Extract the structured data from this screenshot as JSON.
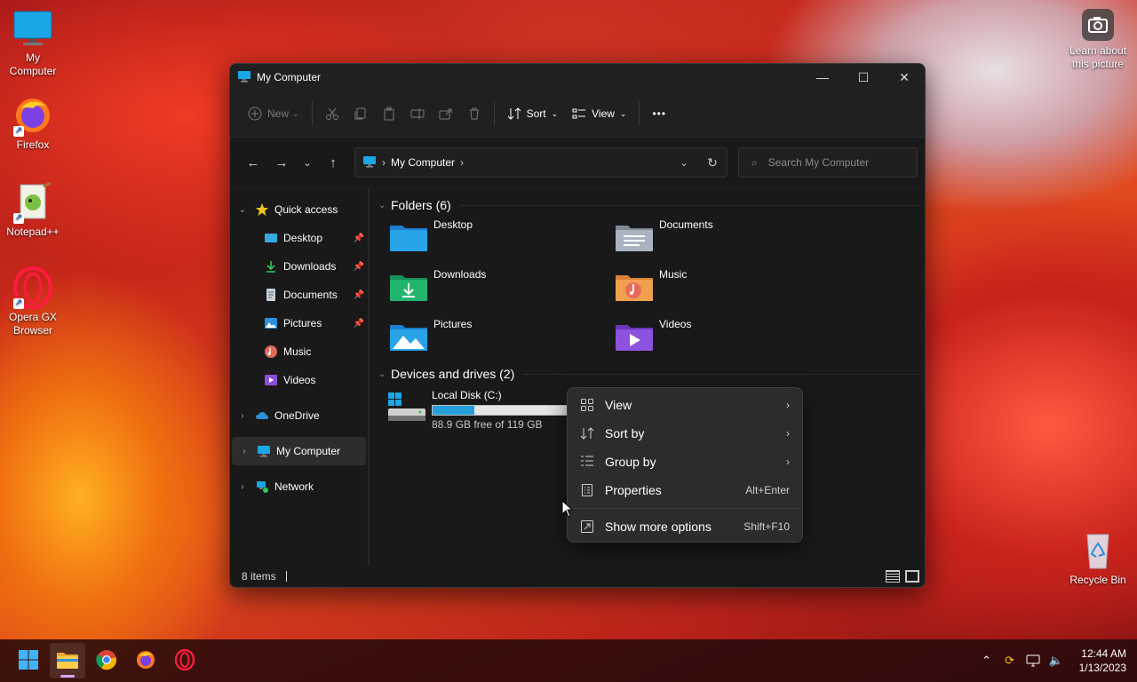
{
  "desktop": {
    "icons": [
      {
        "label_1": "My",
        "label_2": "Computer"
      },
      {
        "label_1": "Firefox"
      },
      {
        "label_1": "Notepad++"
      },
      {
        "label_1": "Opera GX",
        "label_2": "Browser"
      },
      {
        "label_1": "Learn about",
        "label_2": "this picture"
      },
      {
        "label_1": "Recycle Bin"
      }
    ]
  },
  "window": {
    "title": "My Computer",
    "toolbar": {
      "new_label": "New",
      "sort_label": "Sort",
      "view_label": "View",
      "more_label": "•••"
    },
    "address": {
      "location": "My Computer",
      "search_placeholder": "Search My Computer"
    },
    "sidebar": {
      "quick_access": "Quick access",
      "pinned": [
        {
          "label": "Desktop"
        },
        {
          "label": "Downloads"
        },
        {
          "label": "Documents"
        },
        {
          "label": "Pictures"
        }
      ],
      "recent": [
        {
          "label": "Music"
        },
        {
          "label": "Videos"
        }
      ],
      "onedrive": "OneDrive",
      "my_computer": "My Computer",
      "network": "Network"
    },
    "content": {
      "folders_heading": "Folders (6)",
      "folders": [
        {
          "label": "Desktop"
        },
        {
          "label": "Documents"
        },
        {
          "label": "Downloads"
        },
        {
          "label": "Music"
        },
        {
          "label": "Pictures"
        },
        {
          "label": "Videos"
        }
      ],
      "drives_heading": "Devices and drives (2)",
      "drive": {
        "name": "Local Disk (C:)",
        "free_text": "88.9 GB free of 119 GB",
        "used_fraction": 0.25
      }
    },
    "status": {
      "items": "8 items"
    }
  },
  "context_menu": {
    "view": "View",
    "sort_by": "Sort by",
    "group_by": "Group by",
    "properties": "Properties",
    "properties_shortcut": "Alt+Enter",
    "more_options": "Show more options",
    "more_options_shortcut": "Shift+F10"
  },
  "taskbar": {
    "time": "12:44 AM",
    "date": "1/13/2023"
  },
  "colors": {
    "accent": "#26a0da",
    "window_bg": "#202020",
    "menu_bg": "#2c2c2c"
  }
}
